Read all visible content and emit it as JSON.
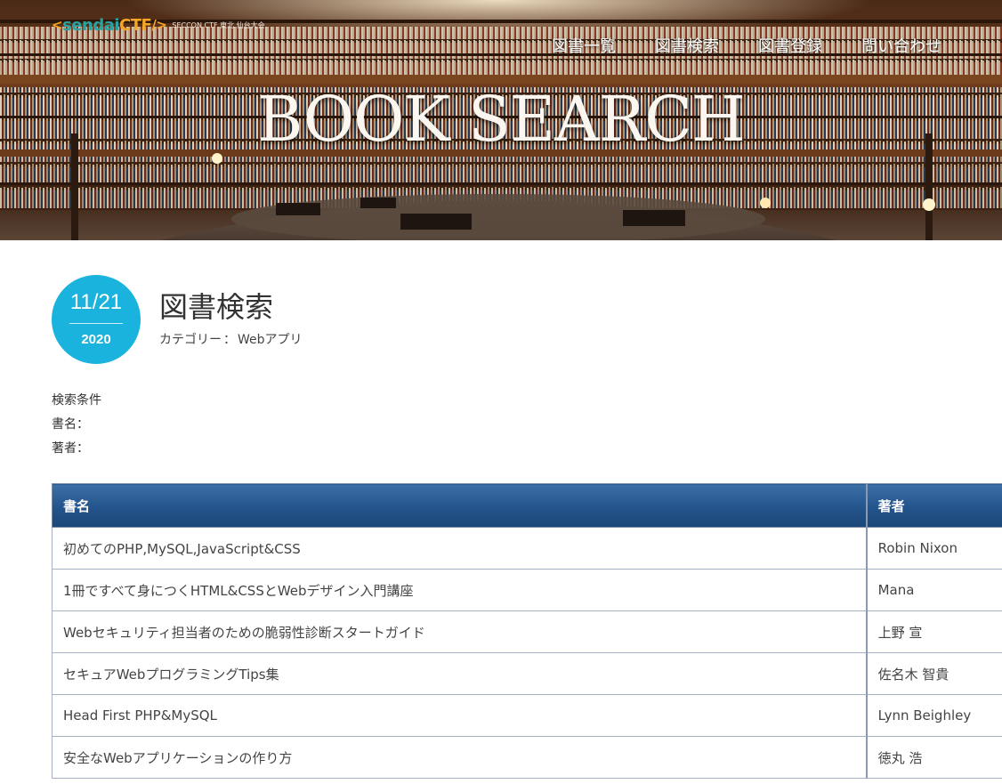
{
  "header": {
    "logo_text_1": "sendai",
    "logo_text_2": "CTF",
    "logo_tagline": "SECCON CTF 東北 仙台大会",
    "hero_title": "BOOK SEARCH",
    "nav": [
      {
        "label": "図書一覧"
      },
      {
        "label": "図書検索"
      },
      {
        "label": "図書登録"
      },
      {
        "label": "問い合わせ"
      }
    ]
  },
  "post": {
    "date_md": "11/21",
    "date_year": "2020",
    "title": "図書検索",
    "category_label": "カテゴリー",
    "category_sep": "：",
    "category_value": "Webアプリ"
  },
  "conditions": {
    "heading": "検索条件",
    "title_label": "書名：",
    "author_label": "著者："
  },
  "table": {
    "headers": [
      "書名",
      "著者"
    ],
    "rows": [
      [
        "初めてのPHP,MySQL,JavaScript&CSS",
        "Robin Nixon"
      ],
      [
        "1冊ですべて身につくHTML&CSSとWebデザイン入門講座",
        "Mana"
      ],
      [
        "Webセキュリティ担当者のための脆弱性診断スタートガイド",
        "上野 宣"
      ],
      [
        "セキュアWebプログラミングTips集",
        "佐名木 智貴"
      ],
      [
        "Head First PHP&MySQL",
        "Lynn Beighley"
      ],
      [
        "安全なWebアプリケーションの作り方",
        "徳丸 浩"
      ]
    ]
  },
  "colors": {
    "accent": "#19b3de",
    "table_header": "#23538b"
  }
}
